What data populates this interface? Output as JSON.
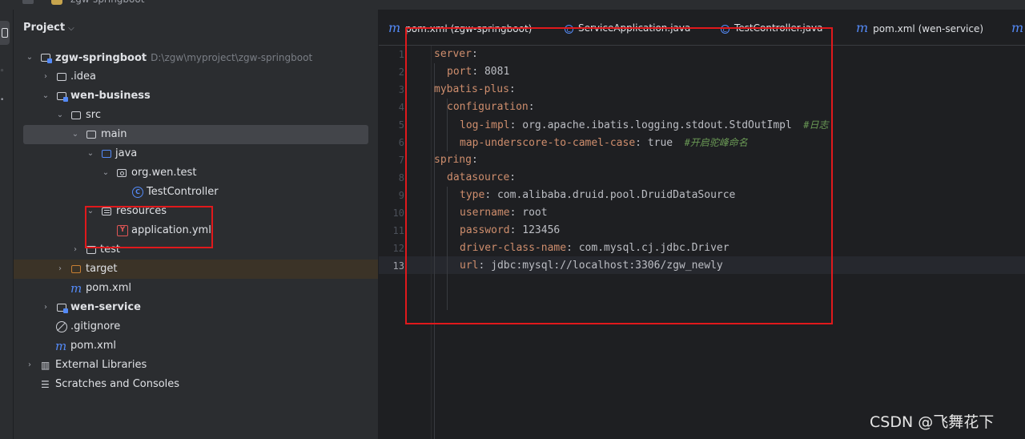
{
  "window": {
    "title": "zgw-springboot"
  },
  "project_panel": {
    "header": "Project",
    "tree": [
      {
        "label": "zgw-springboot",
        "path": "D:\\zgw\\myproject\\zgw-springboot"
      },
      {
        "label": ".idea"
      },
      {
        "label": "wen-business"
      },
      {
        "label": "src"
      },
      {
        "label": "main"
      },
      {
        "label": "java"
      },
      {
        "label": "org.wen.test"
      },
      {
        "label": "TestController"
      },
      {
        "label": "resources"
      },
      {
        "label": "application.yml"
      },
      {
        "label": "test"
      },
      {
        "label": "target"
      },
      {
        "label": "pom.xml"
      },
      {
        "label": "wen-service"
      },
      {
        "label": ".gitignore"
      },
      {
        "label": "pom.xml"
      },
      {
        "label": "External Libraries"
      },
      {
        "label": "Scratches and Consoles"
      }
    ]
  },
  "tabs": [
    {
      "label": "pom.xml (zgw-springboot)",
      "icon": "maven-icon"
    },
    {
      "label": "ServiceApplication.java",
      "icon": "class-icon"
    },
    {
      "label": "TestController.java",
      "icon": "class-icon"
    },
    {
      "label": "pom.xml (wen-service)",
      "icon": "maven-icon"
    }
  ],
  "editor": {
    "line_numbers": [
      "1",
      "2",
      "3",
      "4",
      "5",
      "6",
      "7",
      "8",
      "9",
      "10",
      "11",
      "12",
      "13"
    ],
    "lines": [
      {
        "key": "server",
        "sep": ":",
        "value": "",
        "comment": ""
      },
      {
        "key": "port",
        "sep": ":",
        "value": " 8081",
        "comment": ""
      },
      {
        "key": "mybatis-plus",
        "sep": ":",
        "value": "",
        "comment": ""
      },
      {
        "key": "configuration",
        "sep": ":",
        "value": "",
        "comment": ""
      },
      {
        "key": "log-impl",
        "sep": ":",
        "value": " org.apache.ibatis.logging.stdout.StdOutImpl",
        "comment": "  #日志"
      },
      {
        "key": "map-underscore-to-camel-case",
        "sep": ":",
        "value": " true",
        "comment": "  #开启驼峰命名"
      },
      {
        "key": "spring",
        "sep": ":",
        "value": "",
        "comment": ""
      },
      {
        "key": "datasource",
        "sep": ":",
        "value": "",
        "comment": ""
      },
      {
        "key": "type",
        "sep": ":",
        "value": " com.alibaba.druid.pool.DruidDataSource",
        "comment": ""
      },
      {
        "key": "username",
        "sep": ":",
        "value": " root",
        "comment": ""
      },
      {
        "key": "password",
        "sep": ":",
        "value": " 123456",
        "comment": ""
      },
      {
        "key": "driver-class-name",
        "sep": ":",
        "value": " com.mysql.cj.jdbc.Driver",
        "comment": ""
      },
      {
        "key": "url",
        "sep": ":",
        "value": " jdbc:mysql://localhost:3306/zgw_newly",
        "comment": ""
      }
    ],
    "active_line": "13"
  },
  "watermark": "CSDN @飞舞花下",
  "colors": {
    "key": "#cf8e6d",
    "annotation_red": "#e0191c",
    "icon_blue": "#548af7"
  }
}
